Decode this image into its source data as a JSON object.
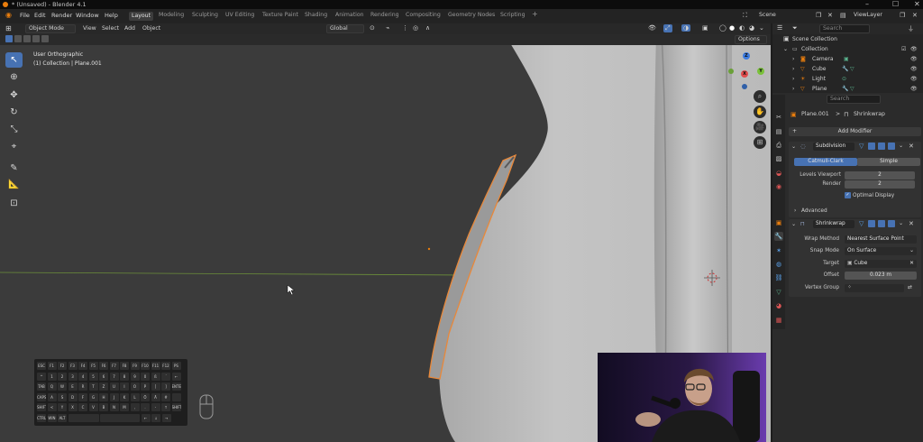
{
  "window": {
    "title": "* (Unsaved) - Blender 4.1",
    "controls": [
      "–",
      "☐",
      "✕"
    ]
  },
  "menu": [
    "File",
    "Edit",
    "Render",
    "Window",
    "Help"
  ],
  "workspaces": [
    "Layout",
    "Modeling",
    "Sculpting",
    "UV Editing",
    "Texture Paint",
    "Shading",
    "Animation",
    "Rendering",
    "Compositing",
    "Geometry Nodes",
    "Scripting"
  ],
  "workspace_add": "+",
  "scene": {
    "name": "Scene",
    "view_layer": "ViewLayer"
  },
  "viewport_header": {
    "mode": "Object Mode",
    "menus": [
      "View",
      "Select",
      "Add",
      "Object"
    ],
    "orientation": "Global",
    "options": "Options"
  },
  "viewport_overlay": {
    "view_name": "User Orthographic",
    "collection_info": "(1) Collection | Plane.001"
  },
  "gizmo": {
    "z": "Z",
    "y": "Y",
    "x": "X"
  },
  "outliner": {
    "search_placeholder": "Search",
    "scene_collection": "Scene Collection",
    "items": [
      {
        "name": "Collection"
      },
      {
        "name": "Camera"
      },
      {
        "name": "Cube"
      },
      {
        "name": "Light"
      },
      {
        "name": "Plane"
      }
    ]
  },
  "properties": {
    "search_placeholder": "Search",
    "breadcrumb_object": "Plane.001",
    "breadcrumb_sep": ">",
    "breadcrumb_modifier": "Shrinkwrap",
    "add_modifier": "Add Modifier",
    "subdivision": {
      "name": "Subdivision",
      "tabs": [
        "Catmull-Clark",
        "Simple"
      ],
      "levels_viewport_label": "Levels Viewport",
      "levels_viewport": "2",
      "render_label": "Render",
      "render": "2",
      "optimal_display": "Optimal Display",
      "advanced": "Advanced"
    },
    "shrinkwrap": {
      "name": "Shrinkwrap",
      "wrap_method_label": "Wrap Method",
      "wrap_method": "Nearest Surface Point",
      "snap_mode_label": "Snap Mode",
      "snap_mode": "On Surface",
      "target_label": "Target",
      "target": "Cube",
      "offset_label": "Offset",
      "offset": "0.023 m",
      "vertex_group_label": "Vertex Group"
    }
  },
  "keyboard": {
    "row1": [
      "ESC",
      "F1",
      "F2",
      "F3",
      "F4",
      "F5",
      "F6",
      "F7",
      "F8",
      "F9",
      "F10",
      "F11",
      "F12",
      "PS"
    ],
    "row2": [
      "^",
      "1",
      "2",
      "3",
      "4",
      "5",
      "6",
      "7",
      "8",
      "9",
      "0",
      "ß",
      "´",
      "←"
    ],
    "row3": [
      "TAB",
      "Q",
      "W",
      "E",
      "R",
      "T",
      "Z",
      "U",
      "I",
      "O",
      "P",
      "[",
      "]",
      "ENTER"
    ],
    "row4": [
      "CAPS",
      "A",
      "S",
      "D",
      "F",
      "G",
      "H",
      "J",
      "K",
      "L",
      "Ö",
      "Ä",
      "#",
      ""
    ],
    "row5": [
      "SHIFT",
      "<",
      "Y",
      "X",
      "C",
      "V",
      "B",
      "N",
      "M",
      ",",
      ".",
      "-",
      "↑",
      "SHIFT"
    ],
    "row6": [
      "CTRL",
      "WIN",
      "ALT",
      "",
      "",
      "←",
      "↓",
      "→"
    ]
  },
  "colors": {
    "accent": "#4772b3",
    "selection_outline": "#e8883a",
    "object_orange": "#e87d0d"
  }
}
